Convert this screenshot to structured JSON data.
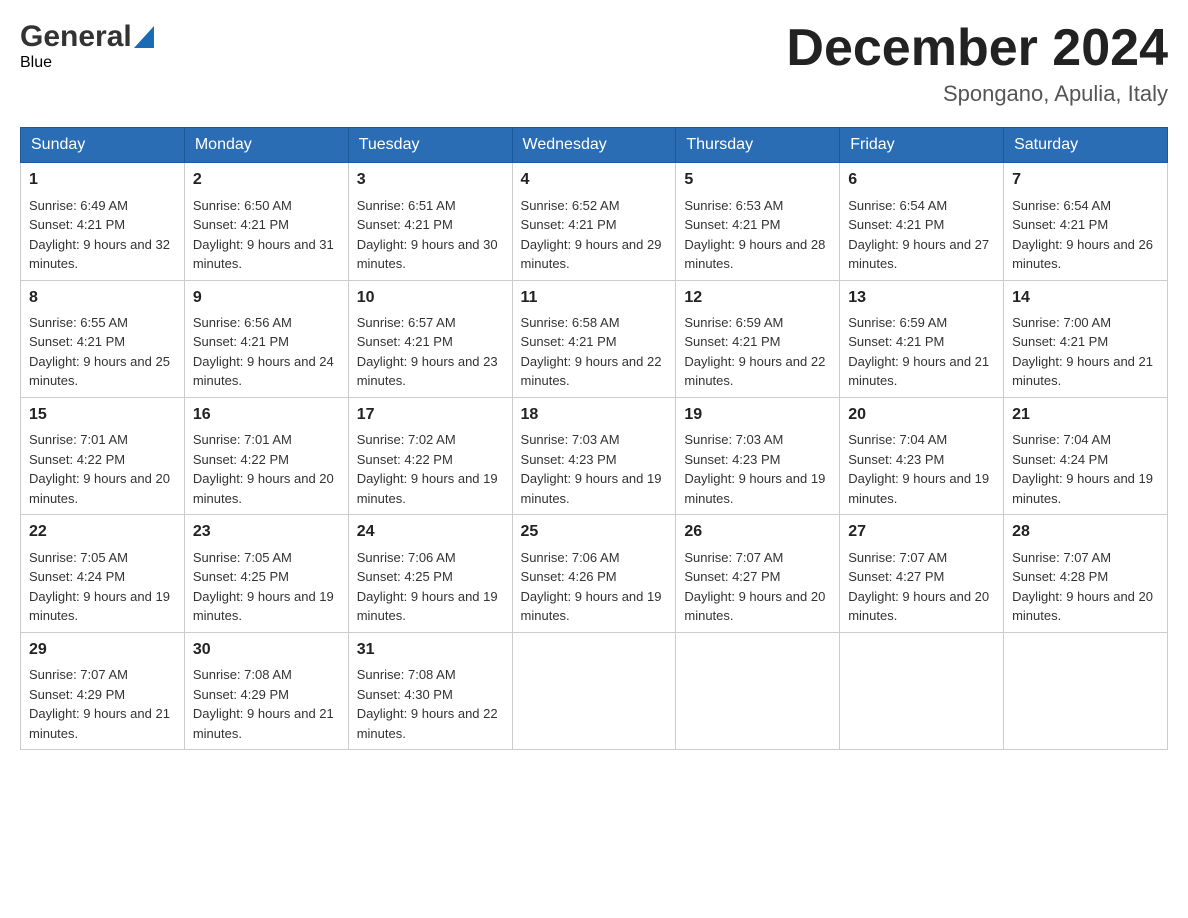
{
  "header": {
    "logo_general": "General",
    "logo_blue": "Blue",
    "month_title": "December 2024",
    "location": "Spongano, Apulia, Italy"
  },
  "weekdays": [
    "Sunday",
    "Monday",
    "Tuesday",
    "Wednesday",
    "Thursday",
    "Friday",
    "Saturday"
  ],
  "weeks": [
    [
      {
        "day": "1",
        "sunrise": "6:49 AM",
        "sunset": "4:21 PM",
        "daylight": "9 hours and 32 minutes."
      },
      {
        "day": "2",
        "sunrise": "6:50 AM",
        "sunset": "4:21 PM",
        "daylight": "9 hours and 31 minutes."
      },
      {
        "day": "3",
        "sunrise": "6:51 AM",
        "sunset": "4:21 PM",
        "daylight": "9 hours and 30 minutes."
      },
      {
        "day": "4",
        "sunrise": "6:52 AM",
        "sunset": "4:21 PM",
        "daylight": "9 hours and 29 minutes."
      },
      {
        "day": "5",
        "sunrise": "6:53 AM",
        "sunset": "4:21 PM",
        "daylight": "9 hours and 28 minutes."
      },
      {
        "day": "6",
        "sunrise": "6:54 AM",
        "sunset": "4:21 PM",
        "daylight": "9 hours and 27 minutes."
      },
      {
        "day": "7",
        "sunrise": "6:54 AM",
        "sunset": "4:21 PM",
        "daylight": "9 hours and 26 minutes."
      }
    ],
    [
      {
        "day": "8",
        "sunrise": "6:55 AM",
        "sunset": "4:21 PM",
        "daylight": "9 hours and 25 minutes."
      },
      {
        "day": "9",
        "sunrise": "6:56 AM",
        "sunset": "4:21 PM",
        "daylight": "9 hours and 24 minutes."
      },
      {
        "day": "10",
        "sunrise": "6:57 AM",
        "sunset": "4:21 PM",
        "daylight": "9 hours and 23 minutes."
      },
      {
        "day": "11",
        "sunrise": "6:58 AM",
        "sunset": "4:21 PM",
        "daylight": "9 hours and 22 minutes."
      },
      {
        "day": "12",
        "sunrise": "6:59 AM",
        "sunset": "4:21 PM",
        "daylight": "9 hours and 22 minutes."
      },
      {
        "day": "13",
        "sunrise": "6:59 AM",
        "sunset": "4:21 PM",
        "daylight": "9 hours and 21 minutes."
      },
      {
        "day": "14",
        "sunrise": "7:00 AM",
        "sunset": "4:21 PM",
        "daylight": "9 hours and 21 minutes."
      }
    ],
    [
      {
        "day": "15",
        "sunrise": "7:01 AM",
        "sunset": "4:22 PM",
        "daylight": "9 hours and 20 minutes."
      },
      {
        "day": "16",
        "sunrise": "7:01 AM",
        "sunset": "4:22 PM",
        "daylight": "9 hours and 20 minutes."
      },
      {
        "day": "17",
        "sunrise": "7:02 AM",
        "sunset": "4:22 PM",
        "daylight": "9 hours and 19 minutes."
      },
      {
        "day": "18",
        "sunrise": "7:03 AM",
        "sunset": "4:23 PM",
        "daylight": "9 hours and 19 minutes."
      },
      {
        "day": "19",
        "sunrise": "7:03 AM",
        "sunset": "4:23 PM",
        "daylight": "9 hours and 19 minutes."
      },
      {
        "day": "20",
        "sunrise": "7:04 AM",
        "sunset": "4:23 PM",
        "daylight": "9 hours and 19 minutes."
      },
      {
        "day": "21",
        "sunrise": "7:04 AM",
        "sunset": "4:24 PM",
        "daylight": "9 hours and 19 minutes."
      }
    ],
    [
      {
        "day": "22",
        "sunrise": "7:05 AM",
        "sunset": "4:24 PM",
        "daylight": "9 hours and 19 minutes."
      },
      {
        "day": "23",
        "sunrise": "7:05 AM",
        "sunset": "4:25 PM",
        "daylight": "9 hours and 19 minutes."
      },
      {
        "day": "24",
        "sunrise": "7:06 AM",
        "sunset": "4:25 PM",
        "daylight": "9 hours and 19 minutes."
      },
      {
        "day": "25",
        "sunrise": "7:06 AM",
        "sunset": "4:26 PM",
        "daylight": "9 hours and 19 minutes."
      },
      {
        "day": "26",
        "sunrise": "7:07 AM",
        "sunset": "4:27 PM",
        "daylight": "9 hours and 20 minutes."
      },
      {
        "day": "27",
        "sunrise": "7:07 AM",
        "sunset": "4:27 PM",
        "daylight": "9 hours and 20 minutes."
      },
      {
        "day": "28",
        "sunrise": "7:07 AM",
        "sunset": "4:28 PM",
        "daylight": "9 hours and 20 minutes."
      }
    ],
    [
      {
        "day": "29",
        "sunrise": "7:07 AM",
        "sunset": "4:29 PM",
        "daylight": "9 hours and 21 minutes."
      },
      {
        "day": "30",
        "sunrise": "7:08 AM",
        "sunset": "4:29 PM",
        "daylight": "9 hours and 21 minutes."
      },
      {
        "day": "31",
        "sunrise": "7:08 AM",
        "sunset": "4:30 PM",
        "daylight": "9 hours and 22 minutes."
      },
      null,
      null,
      null,
      null
    ]
  ],
  "labels": {
    "sunrise_prefix": "Sunrise: ",
    "sunset_prefix": "Sunset: ",
    "daylight_prefix": "Daylight: "
  }
}
